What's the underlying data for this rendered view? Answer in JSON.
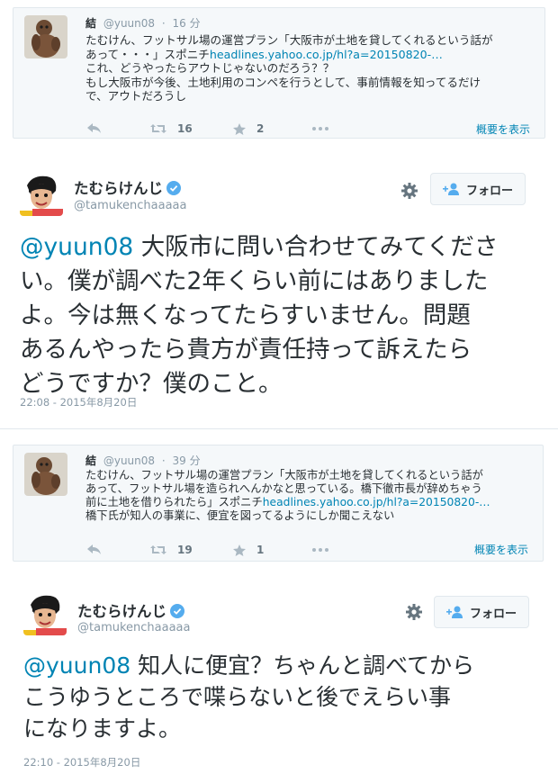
{
  "tweet1": {
    "replied_to": {
      "name": "結",
      "handle": "@yuun08",
      "time": "16 分",
      "lines": [
        "たむけん、フットサル場の運営プラン「大阪市が土地を貸してくれるという話が",
        "あって・・・」スポニチ"
      ],
      "link": "headlines.yahoo.co.jp/hl?a=20150820-…",
      "lines_after": [
        "これ、どうやったらアウトじゃないのだろう？？",
        "もし大阪市が今後、土地利用のコンペを行うとして、事前情報を知ってるだけ",
        "で、アウトだろうし"
      ],
      "retweets": "16",
      "favorites": "2",
      "expand_label": "概要を表示"
    },
    "author": {
      "name": "たむらけんじ",
      "handle": "@tamukenchaaaaa",
      "follow_label": "フォロー"
    },
    "text": {
      "mention": "@yuun08",
      "line1_rest": " 大阪市に問い合わせてみてくださ",
      "lines": [
        "い。僕が調べた2年くらい前にはありました",
        "よ。今は無くなってたらすいません。問題",
        "あるんやったら貴方が責任持って訴えたら",
        "どうですか？僕のこと。"
      ]
    },
    "timestamp": "22:08 - 2015年8月20日"
  },
  "tweet2": {
    "replied_to": {
      "name": "結",
      "handle": "@yuun08",
      "time": "39 分",
      "lines": [
        "たむけん、フットサル場の運営プラン「大阪市が土地を貸してくれるという話が",
        "あって、フットサル場を造られへんかなと思っている。橋下徹市長が辞めちゃう",
        "前に土地を借りられたら」スポニチ"
      ],
      "link": "headlines.yahoo.co.jp/hl?a=20150820-…",
      "lines_after": [
        "橋下氏が知人の事業に、便宜を図ってるようにしか聞こえない"
      ],
      "retweets": "19",
      "favorites": "1",
      "expand_label": "概要を表示"
    },
    "author": {
      "name": "たむらけんじ",
      "handle": "@tamukenchaaaaa",
      "follow_label": "フォロー"
    },
    "text": {
      "mention": "@yuun08",
      "line1_rest": " 知人に便宜？ちゃんと調べてから",
      "lines": [
        "こうゆうところで喋らないと後でえらい事",
        "になりますよ。"
      ]
    },
    "timestamp": "22:10 - 2015年8月20日"
  },
  "colors": {
    "link": "#0084b4",
    "muted": "#8899a6",
    "text": "#292f33",
    "verified": "#55acee",
    "card_bg": "#f5f8fa"
  },
  "icons": [
    "reply-icon",
    "retweet-icon",
    "favorite-icon",
    "more-icon",
    "gear-icon",
    "follow-person-icon",
    "verified-badge-icon"
  ]
}
